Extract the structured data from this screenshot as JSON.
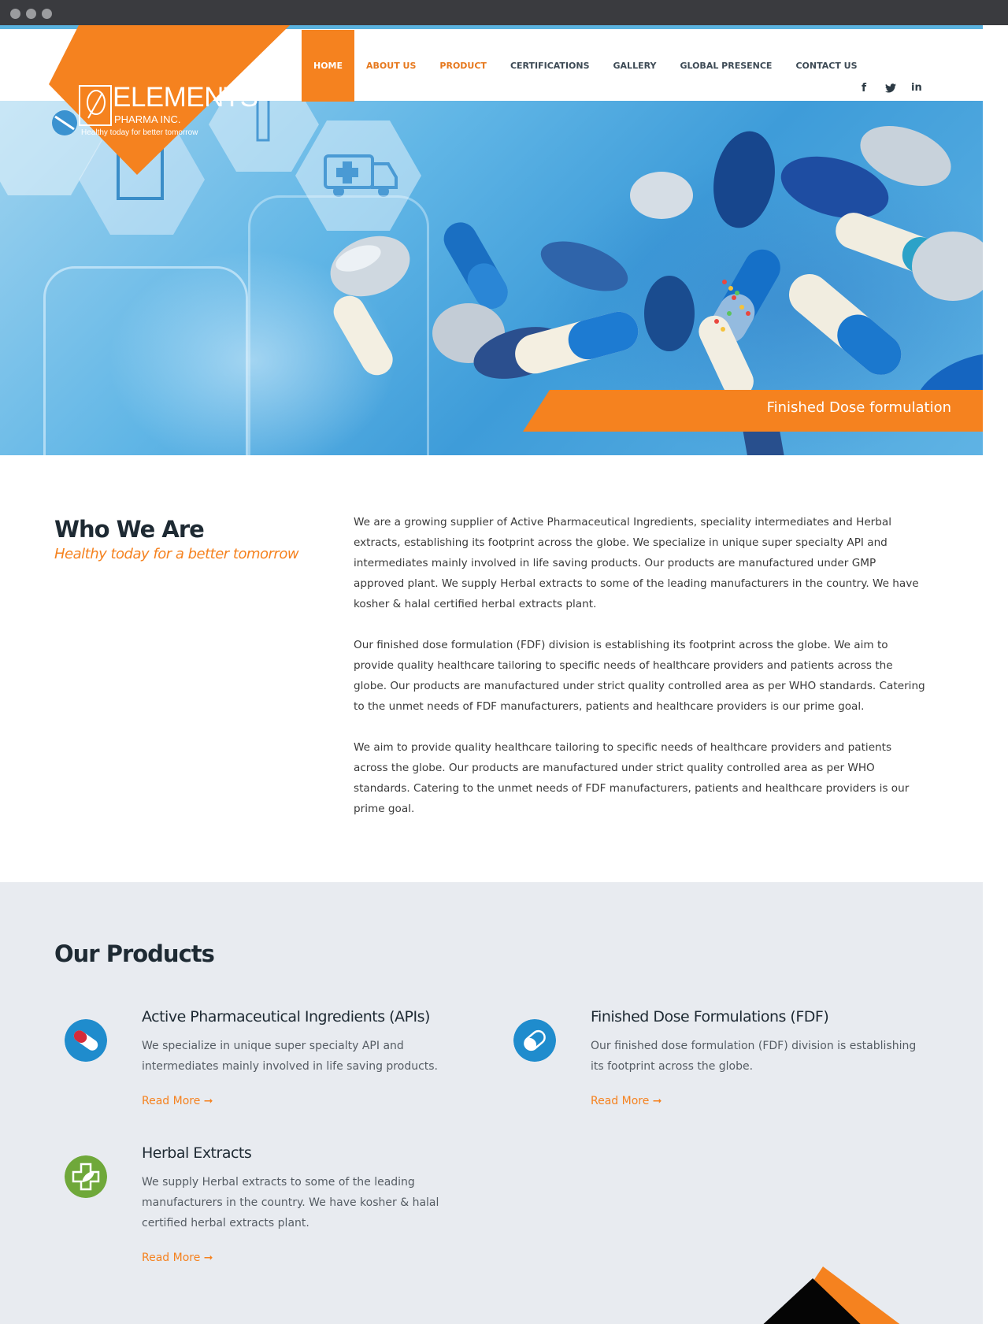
{
  "brand": {
    "name": "ELEMENTS",
    "sub": "PHARMA INC.",
    "tagline": "Healthy today for better tomorrow",
    "accent": "#f5821f",
    "blue": "#1f8ccd",
    "green": "#6fa83a"
  },
  "nav": {
    "items": [
      {
        "label": "HOME"
      },
      {
        "label": "ABOUT US"
      },
      {
        "label": "PRODUCT"
      },
      {
        "label": "CERTIFICATIONS"
      },
      {
        "label": "GALLERY"
      },
      {
        "label": "GLOBAL PRESENCE"
      },
      {
        "label": "CONTACT US"
      }
    ],
    "active": "HOME"
  },
  "social": {
    "facebook_icon": "f",
    "twitter_icon": "twitter-bird",
    "linkedin_icon": "in"
  },
  "hero": {
    "caption": "Finished Dose formulation"
  },
  "who": {
    "title": "Who We Are",
    "subtitle": "Healthy today for a better tomorrow",
    "paragraphs": [
      "We are a growing supplier of Active Pharmaceutical Ingredients, speciality intermediates and Herbal extracts, establishing its footprint across the globe. We specialize in unique super specialty API and intermediates mainly involved in life saving products. Our products are manufactured under GMP approved plant. We supply Herbal extracts to some of the leading manufacturers in the country. We have kosher & halal certified herbal extracts plant.",
      "Our finished dose formulation (FDF) division is establishing its footprint across the globe. We aim to provide quality healthcare tailoring to specific needs of healthcare providers and patients across the globe. Our products are manufactured under strict quality controlled area as per WHO standards. Catering to the unmet needs of FDF manufacturers, patients and healthcare providers is our prime goal.",
      "We aim to provide quality healthcare tailoring to specific needs of healthcare providers and patients across the globe. Our products are manufactured under strict quality controlled area as per WHO standards. Catering to the unmet needs of FDF manufacturers, patients and healthcare providers is our prime goal."
    ]
  },
  "products": {
    "title": "Our Products",
    "items": [
      {
        "title": "Active Pharmaceutical Ingredients (APIs)",
        "desc": "We specialize in unique super specialty API and intermediates mainly involved in life saving products.",
        "link": "Read More ➞",
        "icon": "capsule-icon"
      },
      {
        "title": "Finished Dose Formulations (FDF)",
        "desc": "Our finished dose formulation (FDF) division is establishing its footprint across the globe.",
        "link": "Read More ➞",
        "icon": "pill-icon"
      },
      {
        "title": "Herbal Extracts",
        "desc": "We supply Herbal extracts to some of the leading manufacturers in the country. We have kosher & halal certified herbal extracts plant.",
        "link": "Read More ➞",
        "icon": "herbal-leaf-icon"
      }
    ]
  }
}
